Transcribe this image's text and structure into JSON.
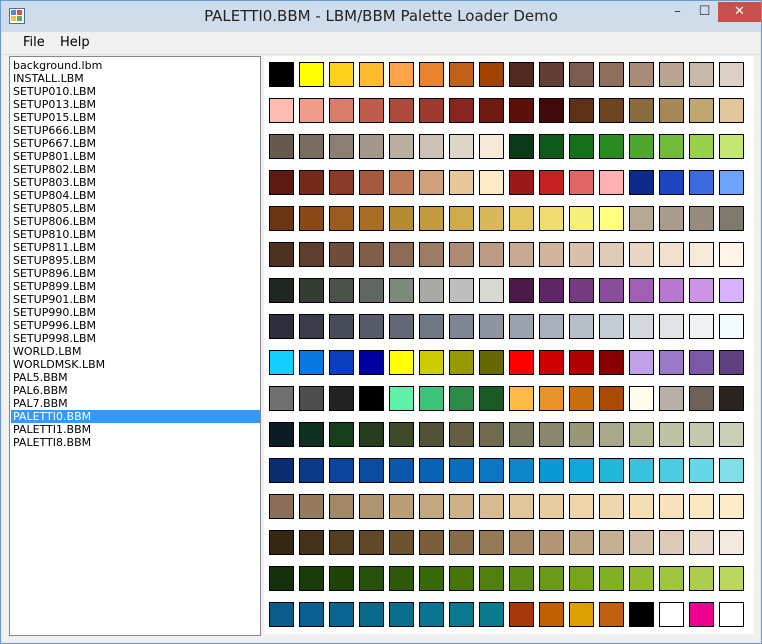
{
  "window": {
    "title": "PALETTI0.BBM - LBM/BBM Palette Loader Demo",
    "controls": {
      "minimize": "–",
      "maximize": "☐",
      "close": "✕"
    }
  },
  "menu": {
    "items": [
      "File",
      "Help"
    ]
  },
  "file_list": {
    "items": [
      "background.lbm",
      "INSTALL.LBM",
      "SETUP010.LBM",
      "SETUP013.LBM",
      "SETUP015.LBM",
      "SETUP666.LBM",
      "SETUP667.LBM",
      "SETUP801.LBM",
      "SETUP802.LBM",
      "SETUP803.LBM",
      "SETUP804.LBM",
      "SETUP805.LBM",
      "SETUP806.LBM",
      "SETUP810.LBM",
      "SETUP811.LBM",
      "SETUP895.LBM",
      "SETUP896.LBM",
      "SETUP899.LBM",
      "SETUP901.LBM",
      "SETUP990.LBM",
      "SETUP996.LBM",
      "SETUP998.LBM",
      "WORLD.LBM",
      "WORLDMSK.LBM",
      "PAL5.BBM",
      "PAL6.BBM",
      "PAL7.BBM",
      "PALETTI0.BBM",
      "PALETTI1.BBM",
      "PALETTI8.BBM"
    ],
    "selected_index": 27
  },
  "palette": {
    "columns": 16,
    "colors": [
      [
        "#000000",
        "#ffff00",
        "#ffd11a",
        "#ffbb2e",
        "#ffa24a",
        "#e8832e",
        "#c0611a",
        "#a04400",
        "#512a1f",
        "#623d34",
        "#7c5c4e",
        "#8f705f",
        "#a88c78",
        "#baa593",
        "#c8b8a8",
        "#ddd0c4"
      ],
      [
        "#ffbcb0",
        "#f09c8c",
        "#d87c6c",
        "#c05c4c",
        "#ae4a3c",
        "#9c3a2f",
        "#892520",
        "#701a14",
        "#5e0f0b",
        "#3f0a07",
        "#5e3018",
        "#6e4523",
        "#8b6a3c",
        "#a88757",
        "#c0a670",
        "#e0c69a"
      ],
      [
        "#665a4d",
        "#7b6d5e",
        "#8c7f72",
        "#a3978a",
        "#b9ae9f",
        "#cbc2b5",
        "#ddd5c8",
        "#f5e9d8",
        "#0a3a17",
        "#0d5a1a",
        "#15701a",
        "#2a8c20",
        "#4ea82e",
        "#71bb3a",
        "#99d04a",
        "#c4e672"
      ],
      [
        "#5c1a12",
        "#74291a",
        "#8b3a28",
        "#a45a3e",
        "#bc7a56",
        "#d0a07a",
        "#e8c79c",
        "#ffe9c6",
        "#9a1818",
        "#c62121",
        "#e06666",
        "#ffb0b0",
        "#0a2a8c",
        "#1c45c0",
        "#3e6ae0",
        "#6fa2ff"
      ],
      [
        "#6c3512",
        "#8a4818",
        "#9c5a1f",
        "#a86e23",
        "#b58a30",
        "#c29b3f",
        "#cfab4c",
        "#dab759",
        "#e4c65f",
        "#eedc6e",
        "#f8ee7c",
        "#ffff82",
        "#b7a893",
        "#a89c8b",
        "#958c7e",
        "#7e7a6c"
      ],
      [
        "#4c3020",
        "#5e3e2c",
        "#704c3a",
        "#805e48",
        "#8c6c56",
        "#9c7c66",
        "#ac8c74",
        "#bc9c84",
        "#c7a890",
        "#d0b49c",
        "#d8c0aa",
        "#e0ccb6",
        "#e8d6c2",
        "#f0e0cc",
        "#f6eada",
        "#fff4e6"
      ],
      [
        "#202622",
        "#343c34",
        "#4a524a",
        "#5e6860",
        "#7c8a7c",
        "#a6aaa2",
        "#bebebe",
        "#d8d8d2",
        "#4a1a48",
        "#5e2664",
        "#753a80",
        "#8c4c9c",
        "#a05eb6",
        "#b878d0",
        "#cc94e6",
        "#d8b2ff"
      ],
      [
        "#2c2e3c",
        "#3a3c4a",
        "#484c5a",
        "#565c6a",
        "#626878",
        "#707886",
        "#7e8694",
        "#8c94a2",
        "#9aa2ae",
        "#a8b0bc",
        "#b6bec8",
        "#c4ccd4",
        "#d2d8de",
        "#e0e4e8",
        "#eef2f4",
        "#f0fcff"
      ],
      [
        "#10d0ff",
        "#0a78e0",
        "#0a3ec0",
        "#0000a0",
        "#ffff00",
        "#cccc00",
        "#989800",
        "#686800",
        "#ff0000",
        "#d00000",
        "#b00000",
        "#880000",
        "#c0a0e8",
        "#9c78c8",
        "#7c58a8",
        "#604080"
      ],
      [
        "#707070",
        "#4e4e4e",
        "#222222",
        "#000000",
        "#5cf2a8",
        "#3ec47a",
        "#2a8c48",
        "#1a5a26",
        "#ffbb44",
        "#e8922a",
        "#c86e0e",
        "#a84a00",
        "#fffaec",
        "#b8b0a6",
        "#6e6258",
        "#2c2420"
      ],
      [
        "#0c1c24",
        "#0e3020",
        "#183e1a",
        "#283c1e",
        "#3e4a2a",
        "#545234",
        "#665e42",
        "#706a4e",
        "#7c7a5e",
        "#8a886c",
        "#989878",
        "#a8a888",
        "#b4b696",
        "#c0c2a4",
        "#c6c8ae",
        "#cacfb8"
      ],
      [
        "#0a2c70",
        "#0a3a88",
        "#0a449c",
        "#0a4ca0",
        "#0a58ac",
        "#0a62b4",
        "#0a6cbc",
        "#0a76c4",
        "#0a88ca",
        "#0a98d0",
        "#10a8d8",
        "#1eb8d8",
        "#38c2de",
        "#4ccce2",
        "#64d8e6",
        "#82dee6"
      ],
      [
        "#8a6e58",
        "#967a60",
        "#a38868",
        "#af9470",
        "#b99e76",
        "#c3a87e",
        "#ccb286",
        "#d6bc90",
        "#e0c698",
        "#e6cc9e",
        "#eed4a8",
        "#f0d6ac",
        "#f6deb4",
        "#f8e2bc",
        "#fae6c0",
        "#fcecc8"
      ],
      [
        "#362612",
        "#46321a",
        "#543e22",
        "#604828",
        "#6c5230",
        "#7a5e3a",
        "#886c48",
        "#967a56",
        "#a48866",
        "#b09674",
        "#bca484",
        "#c6b094",
        "#d2bea6",
        "#dccab6",
        "#e6d8c8",
        "#f2e8dc"
      ],
      [
        "#14300a",
        "#1a3c0a",
        "#1e4406",
        "#285008",
        "#2e5a08",
        "#386808",
        "#46760a",
        "#52800e",
        "#5c8c12",
        "#6a9a16",
        "#76a41c",
        "#82b024",
        "#92ba2e",
        "#a0c43e",
        "#aecc4e",
        "#bcd65e"
      ],
      [
        "#0a5c8a",
        "#0a6090",
        "#0a6690",
        "#0a6a8c",
        "#0a7090",
        "#0a7494",
        "#0a7890",
        "#0a7c90",
        "#a8380a",
        "#c06000",
        "#dca000",
        "#c06010",
        "#000000",
        "#ffffff",
        "#f00090",
        "#ffffff"
      ]
    ]
  }
}
